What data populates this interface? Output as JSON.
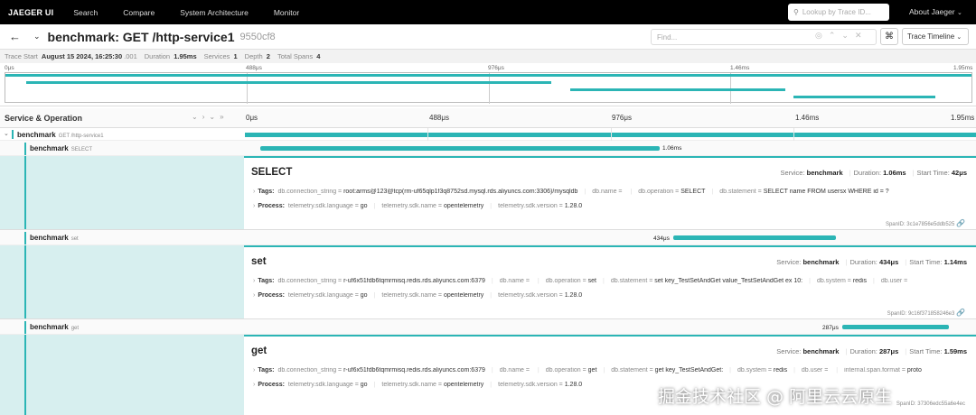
{
  "nav": {
    "brand": "JAEGER UI",
    "items": [
      "Search",
      "Compare",
      "System Architecture",
      "Monitor"
    ],
    "lookup_placeholder": "Lookup by Trace ID...",
    "about": "About Jaeger"
  },
  "title": {
    "service": "benchmark",
    "operation": "GET /http-service1",
    "text": "benchmark: GET /http-service1",
    "trace_id": "9550cf8",
    "find_placeholder": "Find...",
    "view_select": "Trace Timeline"
  },
  "meta": {
    "start_label": "Trace Start",
    "start_value": "August 15 2024, 16:25:30",
    "start_ms": ".001",
    "duration_label": "Duration",
    "duration": "1.95ms",
    "services_label": "Services",
    "services": "1",
    "depth_label": "Depth",
    "depth": "2",
    "spans_label": "Total Spans",
    "spans": "4"
  },
  "ticks": [
    "0μs",
    "488μs",
    "976μs",
    "1.46ms",
    "1.95ms"
  ],
  "header": {
    "label": "Service & Operation"
  },
  "spans": [
    {
      "service": "benchmark",
      "operation": "GET /http-service1",
      "start": 0,
      "duration": 1.95
    },
    {
      "service": "benchmark",
      "operation": "SELECT",
      "duration_label": "1.06ms",
      "start": 0.042,
      "duration": 1.06,
      "detail": {
        "name": "SELECT",
        "service": "benchmark",
        "duration": "1.06ms",
        "start_time": "42μs",
        "tags": [
          [
            "db.connection_string",
            "root:arms@123@tcp(rm-uf65qlp1f3q8752sd.mysql.rds.aliyuncs.com:3306)/mysqldb"
          ],
          [
            "db.name",
            ""
          ],
          [
            "db.operation",
            "SELECT"
          ],
          [
            "db.statement",
            "SELECT name FROM usersx WHERE id = ?"
          ]
        ],
        "process": [
          [
            "telemetry.sdk.language",
            "go"
          ],
          [
            "telemetry.sdk.name",
            "opentelemetry"
          ],
          [
            "telemetry.sdk.version",
            "1.28.0"
          ]
        ],
        "span_id": "3c1e7856e5ddb525"
      }
    },
    {
      "service": "benchmark",
      "operation": "set",
      "duration_label": "434μs",
      "start": 1.14,
      "duration": 0.434,
      "detail": {
        "name": "set",
        "service": "benchmark",
        "duration": "434μs",
        "start_time": "1.14ms",
        "tags": [
          [
            "db.connection_string",
            "r-uf6x51fdb6tqmrmisq.redis.rds.aliyuncs.com:6379"
          ],
          [
            "db.name",
            ""
          ],
          [
            "db.operation",
            "set"
          ],
          [
            "db.statement",
            "set key_TestSetAndGet value_TestSetAndGet ex 10:"
          ],
          [
            "db.system",
            "redis"
          ],
          [
            "db.user",
            ""
          ]
        ],
        "process": [
          [
            "telemetry.sdk.language",
            "go"
          ],
          [
            "telemetry.sdk.name",
            "opentelemetry"
          ],
          [
            "telemetry.sdk.version",
            "1.28.0"
          ]
        ],
        "span_id": "9c16f371858246e3"
      }
    },
    {
      "service": "benchmark",
      "operation": "get",
      "duration_label": "287μs",
      "start": 1.59,
      "duration": 0.287,
      "detail": {
        "name": "get",
        "service": "benchmark",
        "duration": "287μs",
        "start_time": "1.59ms",
        "tags": [
          [
            "db.connection_string",
            "r-uf6x51fdb6tqmrmisq.redis.rds.aliyuncs.com:6379"
          ],
          [
            "db.name",
            ""
          ],
          [
            "db.operation",
            "get"
          ],
          [
            "db.statement",
            "get key_TestSetAndGet:"
          ],
          [
            "db.system",
            "redis"
          ],
          [
            "db.user",
            ""
          ],
          [
            "internal.span.format",
            "proto"
          ]
        ],
        "process": [
          [
            "telemetry.sdk.language",
            "go"
          ],
          [
            "telemetry.sdk.name",
            "opentelemetry"
          ],
          [
            "telemetry.sdk.version",
            "1.28.0"
          ]
        ],
        "span_id": "37306edc55a6e4ec"
      }
    }
  ],
  "detail_labels": {
    "service": "Service:",
    "duration": "Duration:",
    "start_time": "Start Time:",
    "tags": "Tags:",
    "process": "Process:",
    "span_id": "SpanID:"
  },
  "watermark": "掘金技术社区 @ 阿里云云原生",
  "colors": {
    "accent": "#2bb5b5",
    "topbar": "#000000",
    "detail_bg": "#d7efef"
  }
}
